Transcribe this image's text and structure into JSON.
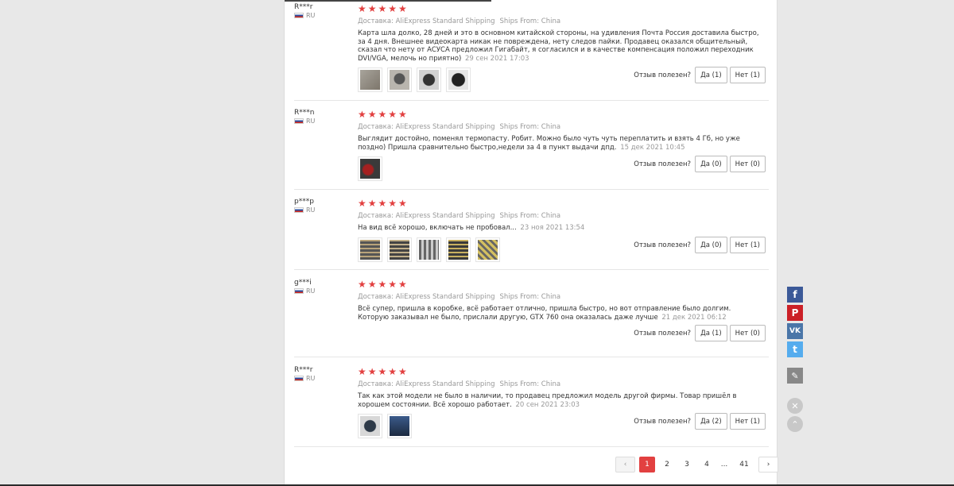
{
  "shipping_label": "Доставка: AliExpress Standard Shipping",
  "ships_from": "Ships From: China",
  "helpful_label": "Отзыв полезен?",
  "stars": "★★★★★",
  "reviews": [
    {
      "user": "R***r",
      "country": "RU",
      "text": "Карта шла долко, 28 дней и это в основном китайской стороны, на удивления Почта Россия доставила быстро, за 4 дня. Внешнее видеокарта никак не повреждена, нету следов пайки. Продавец оказался общительный, сказал что нету от АСУСА предложил Гигабайт, я согласился и в качестве компенсация положил переходник DVI/VGA, мелочь но приятно)",
      "date": "29 сен 2021 17:03",
      "yes": "Да (1)",
      "no": "Нет (1)"
    },
    {
      "user": "R***n",
      "country": "RU",
      "text": "Выглядит достойно, поменял термопасту. Робит. Можно было чуть чуть переплатить и взять 4 Гб, но уже поздно) Пришла сравнительно быстро,недели за 4 в пункт выдачи дпд.",
      "date": "15 дек 2021 10:45",
      "yes": "Да (0)",
      "no": "Нет (0)"
    },
    {
      "user": "p***p",
      "country": "RU",
      "text": "На вид всё хорошо, включать не пробовал...",
      "date": "23 ноя 2021 13:54",
      "yes": "Да (0)",
      "no": "Нет (1)"
    },
    {
      "user": "g***i",
      "country": "RU",
      "text": "Всё супер, пришла в коробке, всё работает отлично, пришла быстро, но вот отправление было долгим. Которую заказывал не было, прислали другую, GTX 760 она оказалась даже лучше",
      "date": "21 дек 2021 06:12",
      "yes": "Да (1)",
      "no": "Нет (0)"
    },
    {
      "user": "R***r",
      "country": "RU",
      "text": "Так как этой модели не было в наличии, то продавец предложил модель другой фирмы. Товар пришёл в хорошем состоянии. Всё хорошо работает.",
      "date": "20 сен 2021 23:03",
      "yes": "Да (2)",
      "no": "Нет (1)"
    }
  ],
  "pagination": {
    "prev": "‹",
    "pages": [
      "1",
      "2",
      "3",
      "4"
    ],
    "ellipsis": "...",
    "last": "41",
    "next": "›"
  },
  "social": {
    "facebook": "f",
    "pinterest": "P",
    "vk": "VK",
    "twitter": "t",
    "edit": "✎",
    "close": "✕",
    "up": "⌃"
  },
  "colors": {
    "accent": "#e24040",
    "facebook": "#3b5998",
    "pinterest": "#cb2027",
    "vk": "#4a76a8",
    "twitter": "#55acee"
  },
  "icons": [
    "star-icon",
    "flag-icon",
    "facebook-icon",
    "pinterest-icon",
    "vk-icon",
    "twitter-icon",
    "edit-icon",
    "close-icon",
    "scroll-up-icon"
  ]
}
